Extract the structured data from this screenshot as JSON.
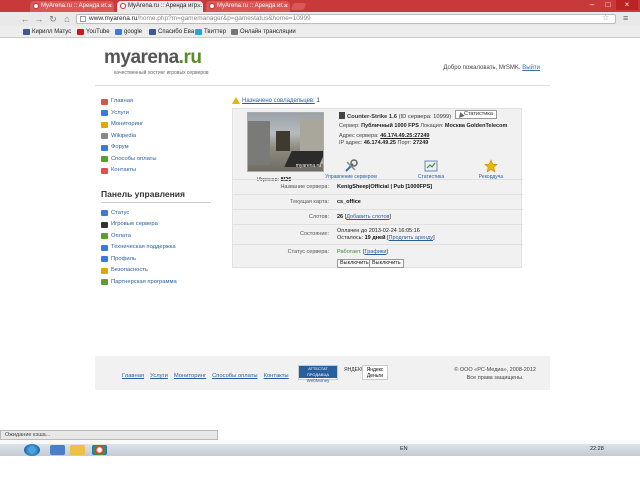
{
  "browser": {
    "tabs": [
      {
        "label": "MyArena.ru :: Аренда иг..."
      },
      {
        "label": "MyArena.ru :: Аренда игр..."
      },
      {
        "label": "MyArena.ru :: Аренда иг..."
      }
    ],
    "tab_close": "×",
    "win_controls": {
      "min": "–",
      "max": "□",
      "close": "×"
    },
    "url_host": "www.myarena.ru",
    "url_path": "/home.php?m=gamemanager&p=gamestatus&home=10999",
    "nav": {
      "back": "←",
      "forward": "→",
      "reload": "↻",
      "home": "⌂"
    },
    "star": "☆",
    "menu": "≡",
    "bookmarks": [
      {
        "label": "Кирилл Матус",
        "color": "#3b5998"
      },
      {
        "label": "YouTube",
        "color": "#cc1a1a"
      },
      {
        "label": "google",
        "color": "#3a7bd5"
      },
      {
        "label": "Спасибо Ева",
        "color": "#3b5998"
      },
      {
        "label": "Твиттер",
        "color": "#2aa3dc"
      },
      {
        "label": "Онлайн трансляции",
        "color": "#777777"
      }
    ],
    "status_text": "Ожидание кэша..."
  },
  "header": {
    "logo_main": "myarena",
    "logo_suffix": ".ru",
    "tagline": "качественный хостинг игровых серверов",
    "welcome": "Добро пожаловать, MrSMK.",
    "exit": "Выйти"
  },
  "sidebar": {
    "items": [
      {
        "label": "Главная",
        "color": "#d9534f"
      },
      {
        "label": "Услуги",
        "color": "#3a7bd5"
      },
      {
        "label": "Мониторинг",
        "color": "#e0a800"
      },
      {
        "label": "Wikipedia",
        "color": "#888888"
      },
      {
        "label": "Форум",
        "color": "#3a7bd5"
      },
      {
        "label": "Способы оплаты",
        "color": "#5aa02c"
      },
      {
        "label": "Контакты",
        "color": "#d9534f"
      }
    ],
    "panel_title": "Панель управления",
    "panel_items": [
      {
        "label": "Статус",
        "color": "#3a7bd5"
      },
      {
        "label": "Игровые сервера",
        "color": "#333333"
      },
      {
        "label": "Оплата",
        "color": "#5aa02c"
      },
      {
        "label": "Техническая поддержка",
        "color": "#3a7bd5"
      },
      {
        "label": "Профиль",
        "color": "#3a7bd5"
      },
      {
        "label": "Безопасность",
        "color": "#e0a800"
      },
      {
        "label": "Партнерская программа",
        "color": "#5aa02c"
      }
    ]
  },
  "server": {
    "assigned_label": "Назначено совладельцев:",
    "assigned_count": "1",
    "game": "Counter-Strike 1.6",
    "id_text": "(ID сервера: 10999)",
    "stats_button": "Статистика",
    "server_line_label": "Сервер:",
    "server_type": "Публичный 1000 FPS",
    "location_label": "Локация:",
    "location": "Москва GoldenTelecom",
    "addr_label": "Адрес сервера:",
    "addr": "46.174.49.25:27249",
    "ip_label": "IP адрес:",
    "ip": "46.174.49.25",
    "port_label": "Порт:",
    "port": "27249",
    "thumb_mark": "myarena.ru",
    "players_label": "Игроков:",
    "players": "8/26",
    "actions": [
      "Управление сервером",
      "Статистика",
      "Рекордуча"
    ],
    "rows": {
      "name_label": "Название сервера:",
      "name": "KenigSheep|Official | Pub [1000FPS]",
      "map_label": "Текущая карта:",
      "map": "cs_office",
      "slots_label": "Слотов:",
      "slots": "26",
      "slots_add": "Добавить слотов",
      "state_label": "Состояние:",
      "state_line1": "Оплачен до 2013-02-24 16:05:16",
      "state_line2_pre": "Осталось:",
      "state_days": "19 дней",
      "state_extend": "Продлить аренду",
      "status_label": "Статус сервера:",
      "status": "Работает.",
      "status_graph": "Графики"
    },
    "btn_off": "Выключить",
    "btn_restart": "Выключить"
  },
  "footer": {
    "links": [
      "Главная",
      "Услуги",
      "Мониторинг",
      "Способы оплаты",
      "Контакты"
    ],
    "wm_top": "АТТЕСТАТ ПРОДАВЦА",
    "wm_main": "WebMoney",
    "yd_left": "ЯНДЕКС",
    "yd_right": "Яндекс Деньги",
    "copyright1": "© ООО «РС-Медиа», 2008-2012",
    "copyright2": "Все права защищены."
  },
  "taskbar": {
    "lang": "EN",
    "clock": "22:28"
  }
}
